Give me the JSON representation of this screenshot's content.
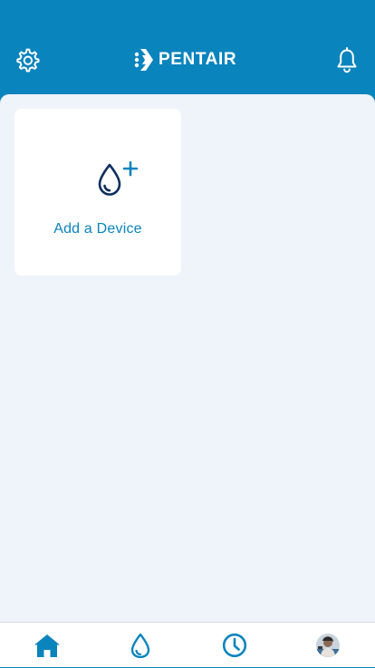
{
  "header": {
    "brand": "PENTAIR",
    "settings_icon": "gear-icon",
    "notifications_icon": "bell-icon"
  },
  "devices": {
    "add_label": "Add a Device",
    "add_icon": "water-drop-plus-icon"
  },
  "tabbar": {
    "items": [
      {
        "icon": "home-icon",
        "active": true
      },
      {
        "icon": "water-drop-icon",
        "active": false
      },
      {
        "icon": "clock-icon",
        "active": false
      },
      {
        "icon": "avatar",
        "active": false
      }
    ]
  },
  "colors": {
    "brand": "#0a84bd",
    "background": "#eef4fa",
    "card": "#ffffff",
    "icon_dark": "#0d2f5e"
  }
}
